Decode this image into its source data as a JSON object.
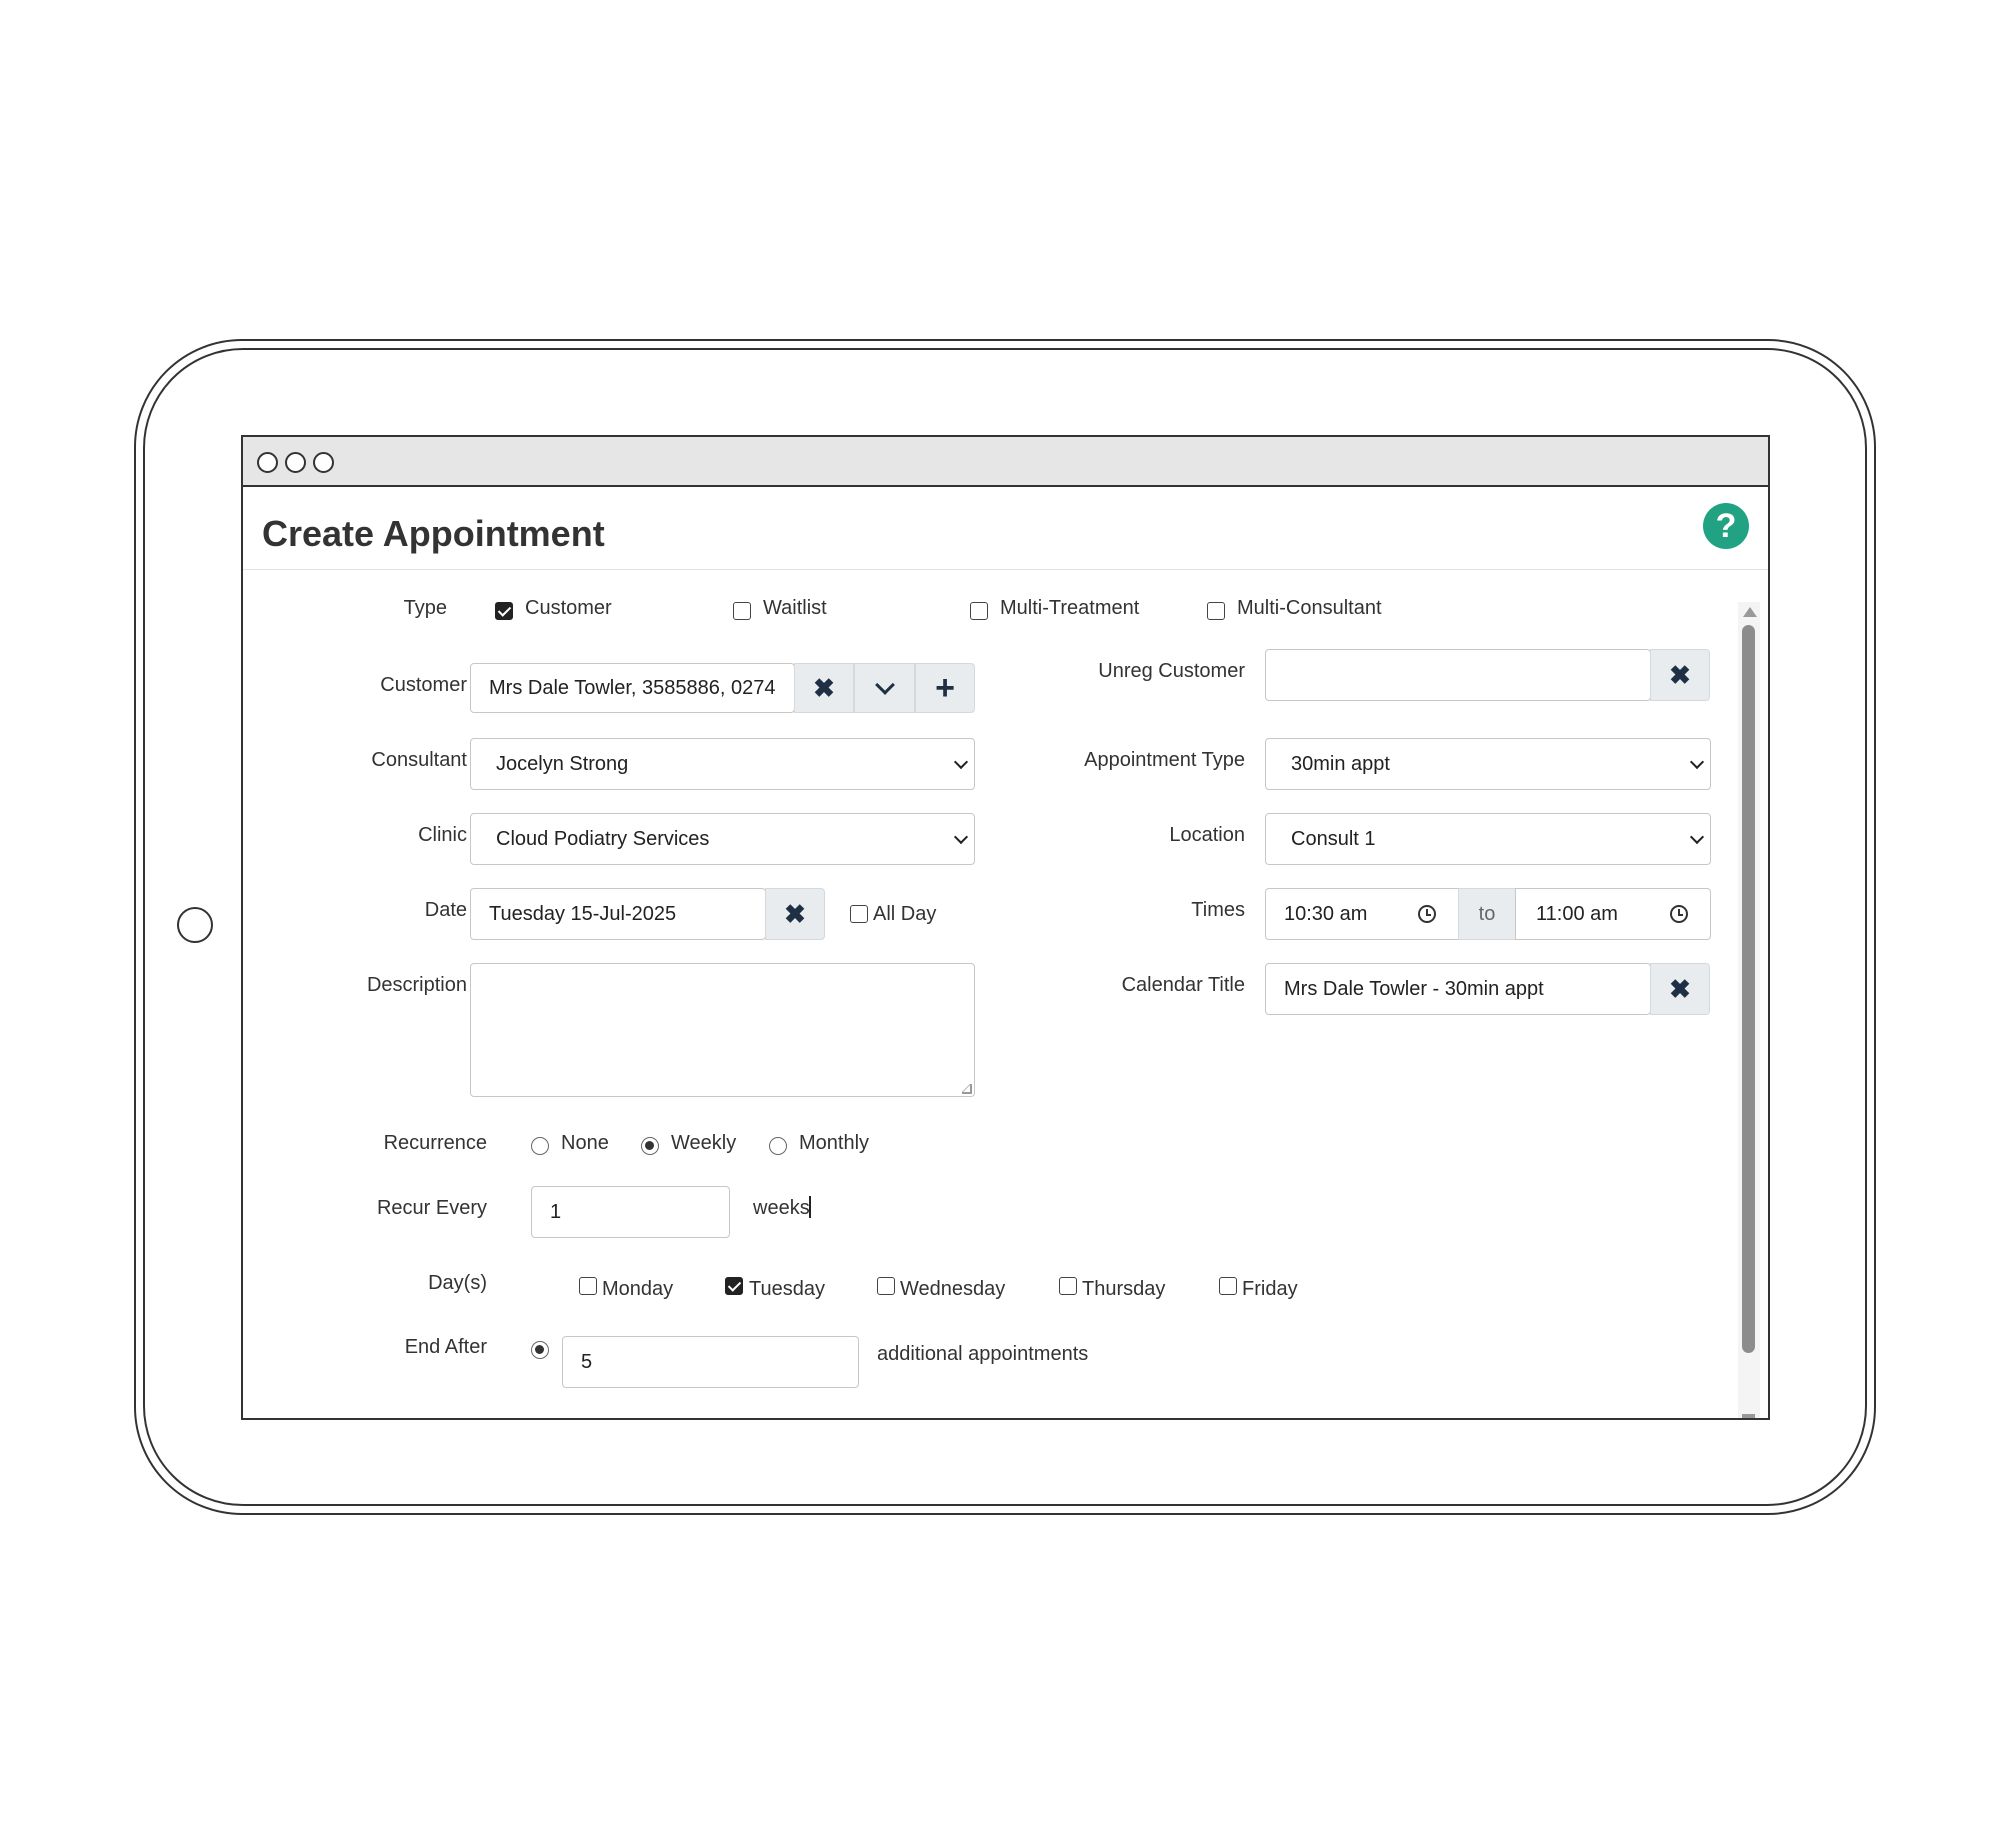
{
  "page": {
    "title": "Create Appointment"
  },
  "colors": {
    "help_icon": "#21a383",
    "addon_bg": "#e9ecef",
    "icon_dark": "#1f3044"
  },
  "icons": {
    "help": "question-mark-circle",
    "clear": "x-mark",
    "dropdown": "chevron-down",
    "add": "plus",
    "clock": "clock"
  },
  "form": {
    "type": {
      "label": "Type",
      "options": [
        {
          "label": "Customer",
          "checked": true
        },
        {
          "label": "Waitlist",
          "checked": false
        },
        {
          "label": "Multi-Treatment",
          "checked": false
        },
        {
          "label": "Multi-Consultant",
          "checked": false
        }
      ]
    },
    "customer": {
      "label": "Customer",
      "value": "Mrs Dale Towler, 3585886, 0274"
    },
    "unreg_customer": {
      "label": "Unreg Customer",
      "value": ""
    },
    "consultant": {
      "label": "Consultant",
      "value": "Jocelyn Strong"
    },
    "appointment_type": {
      "label": "Appointment Type",
      "value": "30min appt"
    },
    "clinic": {
      "label": "Clinic",
      "value": "Cloud Podiatry Services"
    },
    "location": {
      "label": "Location",
      "value": "Consult 1"
    },
    "date": {
      "label": "Date",
      "value": "Tuesday 15-Jul-2025",
      "all_day_label": "All Day",
      "all_day_checked": false
    },
    "times": {
      "label": "Times",
      "start": "10:30 am",
      "separator": "to",
      "end": "11:00 am"
    },
    "description": {
      "label": "Description",
      "value": ""
    },
    "calendar_title": {
      "label": "Calendar Title",
      "value": "Mrs Dale Towler - 30min appt"
    },
    "recurrence": {
      "label": "Recurrence",
      "options": [
        {
          "label": "None",
          "checked": false
        },
        {
          "label": "Weekly",
          "checked": true
        },
        {
          "label": "Monthly",
          "checked": false
        }
      ]
    },
    "recur_every": {
      "label": "Recur Every",
      "value": "1",
      "unit": "weeks"
    },
    "days": {
      "label": "Day(s)",
      "options": [
        {
          "label": "Monday",
          "checked": false
        },
        {
          "label": "Tuesday",
          "checked": true
        },
        {
          "label": "Wednesday",
          "checked": false
        },
        {
          "label": "Thursday",
          "checked": false
        },
        {
          "label": "Friday",
          "checked": false
        }
      ]
    },
    "end_after": {
      "label": "End After",
      "value": "5",
      "suffix": "additional appointments",
      "selected": true
    }
  }
}
